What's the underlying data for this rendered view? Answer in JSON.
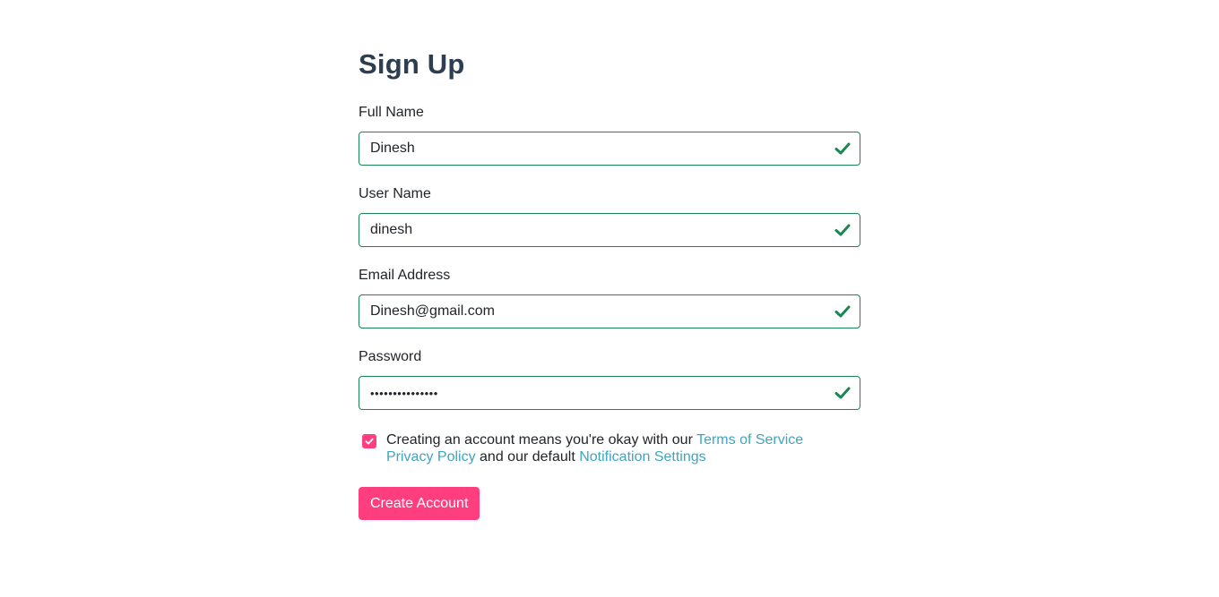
{
  "form": {
    "title": "Sign Up",
    "fields": [
      {
        "label": "Full Name",
        "value": "Dinesh",
        "type": "text",
        "valid": true
      },
      {
        "label": "User Name",
        "value": "dinesh",
        "type": "text",
        "valid": true
      },
      {
        "label": "Email Address",
        "value": "Dinesh@gmail.com",
        "type": "email",
        "valid": true
      },
      {
        "label": "Password",
        "value": "•••••••••••••••",
        "type": "password",
        "valid": true
      }
    ],
    "valid_icon": "check-icon",
    "consent": {
      "checked": true,
      "text_1": "Creating an account means you're okay with our ",
      "terms_link": "Terms of Service",
      "privacy_link": "Privacy Policy",
      "text_2": " and our default ",
      "notification_link": "Notification Settings"
    },
    "submit_label": "Create Account"
  },
  "colors": {
    "accent": "#ff3e7f",
    "valid": "#198754",
    "link": "#3fa5bd",
    "title": "#2c3e50"
  }
}
